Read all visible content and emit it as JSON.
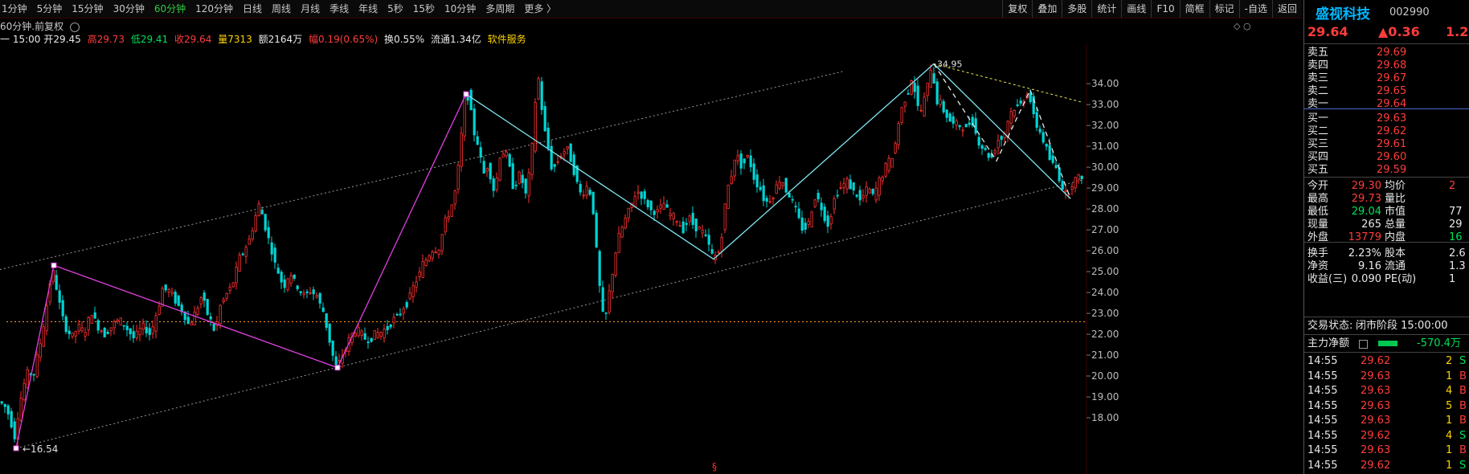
{
  "toolbar": {
    "periods": [
      "1分钟",
      "5分钟",
      "15分钟",
      "30分钟",
      "60分钟",
      "120分钟",
      "日线",
      "周线",
      "月线",
      "季线",
      "年线",
      "5秒",
      "15秒",
      "10分钟",
      "多周期",
      "更多 〉"
    ],
    "active_period": "60分钟",
    "tools": [
      "复权",
      "叠加",
      "多股",
      "统计",
      "画线",
      "F10",
      "简框",
      "标记",
      "-自选",
      "返回"
    ]
  },
  "chart_header": {
    "subtitle": "60分钟.前复权",
    "time": "一 15:00",
    "open_label": "开",
    "open": "29.45",
    "high_label": "高",
    "high": "29.73",
    "low_label": "低",
    "low": "29.41",
    "close_label": "收",
    "close": "29.64",
    "vol_label": "量",
    "vol": "7313",
    "amount_label": "额",
    "amount": "2164万",
    "change_label": "幅",
    "change": "0.19(0.65%)",
    "turnover_label": "换",
    "turnover": "0.55%",
    "float_label": "流通",
    "float": "1.34亿",
    "sector": "软件服务"
  },
  "chart_data": {
    "type": "candlestick",
    "ylim": [
      17.0,
      35.2
    ],
    "y_ticks": [
      "34.00",
      "33.00",
      "32.00",
      "31.00",
      "30.00",
      "29.00",
      "28.00",
      "27.00",
      "26.00",
      "25.00",
      "24.00",
      "23.00",
      "22.00",
      "21.00",
      "20.00",
      "19.00",
      "18.00"
    ],
    "price_path": [
      [
        0,
        18.8
      ],
      [
        8,
        18.6
      ],
      [
        12,
        18.3
      ],
      [
        16,
        18.0
      ],
      [
        20,
        16.9
      ],
      [
        26,
        18.3
      ],
      [
        32,
        19.5
      ],
      [
        38,
        20.2
      ],
      [
        45,
        20.1
      ],
      [
        52,
        21.4
      ],
      [
        58,
        22.6
      ],
      [
        63,
        23.8
      ],
      [
        67,
        25.3
      ],
      [
        72,
        24.4
      ],
      [
        78,
        23.2
      ],
      [
        85,
        22.3
      ],
      [
        92,
        21.8
      ],
      [
        100,
        22.4
      ],
      [
        108,
        22.0
      ],
      [
        116,
        23.1
      ],
      [
        124,
        22.4
      ],
      [
        132,
        22.0
      ],
      [
        140,
        22.3
      ],
      [
        150,
        22.7
      ],
      [
        160,
        22.3
      ],
      [
        170,
        21.8
      ],
      [
        180,
        22.4
      ],
      [
        190,
        22.0
      ],
      [
        198,
        23.0
      ],
      [
        206,
        24.3
      ],
      [
        214,
        24.0
      ],
      [
        222,
        23.6
      ],
      [
        230,
        23.1
      ],
      [
        238,
        22.4
      ],
      [
        246,
        23.0
      ],
      [
        254,
        23.9
      ],
      [
        262,
        22.9
      ],
      [
        270,
        22.1
      ],
      [
        278,
        23.5
      ],
      [
        286,
        24.0
      ],
      [
        294,
        24.6
      ],
      [
        302,
        25.8
      ],
      [
        310,
        26.2
      ],
      [
        318,
        27.2
      ],
      [
        325,
        28.2
      ],
      [
        332,
        27.3
      ],
      [
        340,
        26.1
      ],
      [
        348,
        25.0
      ],
      [
        356,
        24.3
      ],
      [
        364,
        24.9
      ],
      [
        372,
        24.3
      ],
      [
        380,
        23.8
      ],
      [
        388,
        24.1
      ],
      [
        396,
        23.9
      ],
      [
        404,
        23.2
      ],
      [
        412,
        21.9
      ],
      [
        420,
        20.4
      ],
      [
        428,
        20.9
      ],
      [
        436,
        21.6
      ],
      [
        444,
        22.2
      ],
      [
        452,
        22.0
      ],
      [
        460,
        21.7
      ],
      [
        470,
        22.0
      ],
      [
        480,
        22.1
      ],
      [
        490,
        22.6
      ],
      [
        500,
        23.0
      ],
      [
        510,
        23.6
      ],
      [
        520,
        24.5
      ],
      [
        530,
        25.4
      ],
      [
        540,
        26.0
      ],
      [
        550,
        26.1
      ],
      [
        556,
        27.4
      ],
      [
        564,
        28.0
      ],
      [
        570,
        29.0
      ],
      [
        576,
        31.0
      ],
      [
        580,
        33.2
      ],
      [
        586,
        33.5
      ],
      [
        592,
        31.8
      ],
      [
        598,
        31.0
      ],
      [
        604,
        29.6
      ],
      [
        610,
        30.2
      ],
      [
        618,
        28.7
      ],
      [
        626,
        30.8
      ],
      [
        634,
        30.5
      ],
      [
        642,
        29.0
      ],
      [
        650,
        29.7
      ],
      [
        658,
        28.6
      ],
      [
        664,
        30.5
      ],
      [
        670,
        33.6
      ],
      [
        674,
        34.5
      ],
      [
        678,
        32.2
      ],
      [
        684,
        31.2
      ],
      [
        690,
        29.8
      ],
      [
        696,
        30.3
      ],
      [
        702,
        30.7
      ],
      [
        710,
        30.9
      ],
      [
        718,
        29.7
      ],
      [
        726,
        28.6
      ],
      [
        734,
        29.1
      ],
      [
        740,
        28.4
      ],
      [
        746,
        25.5
      ],
      [
        752,
        23.0
      ],
      [
        756,
        22.7
      ],
      [
        760,
        23.8
      ],
      [
        766,
        25.2
      ],
      [
        772,
        26.6
      ],
      [
        780,
        27.4
      ],
      [
        788,
        28.2
      ],
      [
        796,
        28.9
      ],
      [
        804,
        28.5
      ],
      [
        812,
        28.0
      ],
      [
        820,
        27.8
      ],
      [
        828,
        28.3
      ],
      [
        836,
        27.7
      ],
      [
        844,
        27.5
      ],
      [
        852,
        27.0
      ],
      [
        860,
        27.6
      ],
      [
        868,
        27.2
      ],
      [
        876,
        26.9
      ],
      [
        884,
        26.4
      ],
      [
        890,
        25.6
      ],
      [
        896,
        25.8
      ],
      [
        902,
        27.0
      ],
      [
        906,
        28.6
      ],
      [
        912,
        29.5
      ],
      [
        918,
        30.6
      ],
      [
        926,
        30.1
      ],
      [
        934,
        30.6
      ],
      [
        940,
        29.6
      ],
      [
        948,
        29.0
      ],
      [
        956,
        28.3
      ],
      [
        964,
        28.6
      ],
      [
        972,
        29.4
      ],
      [
        978,
        29.2
      ],
      [
        984,
        28.7
      ],
      [
        990,
        28.2
      ],
      [
        996,
        27.6
      ],
      [
        1002,
        27.0
      ],
      [
        1010,
        27.4
      ],
      [
        1018,
        28.8
      ],
      [
        1026,
        27.9
      ],
      [
        1034,
        27.2
      ],
      [
        1042,
        28.7
      ],
      [
        1050,
        29.1
      ],
      [
        1058,
        29.3
      ],
      [
        1066,
        28.8
      ],
      [
        1074,
        28.4
      ],
      [
        1082,
        29.0
      ],
      [
        1090,
        28.6
      ],
      [
        1098,
        29.4
      ],
      [
        1106,
        30.1
      ],
      [
        1114,
        30.5
      ],
      [
        1120,
        31.9
      ],
      [
        1126,
        33.0
      ],
      [
        1132,
        33.6
      ],
      [
        1138,
        34.3
      ],
      [
        1144,
        33.0
      ],
      [
        1150,
        32.6
      ],
      [
        1156,
        33.8
      ],
      [
        1162,
        34.9
      ],
      [
        1168,
        33.2
      ],
      [
        1174,
        33.0
      ],
      [
        1180,
        32.5
      ],
      [
        1188,
        32.1
      ],
      [
        1196,
        32.0
      ],
      [
        1204,
        31.8
      ],
      [
        1212,
        32.4
      ],
      [
        1220,
        31.2
      ],
      [
        1228,
        30.8
      ],
      [
        1236,
        30.4
      ],
      [
        1244,
        31.3
      ],
      [
        1252,
        31.5
      ],
      [
        1260,
        32.6
      ],
      [
        1268,
        32.9
      ],
      [
        1276,
        33.2
      ],
      [
        1282,
        33.7
      ],
      [
        1288,
        32.6
      ],
      [
        1294,
        31.9
      ],
      [
        1300,
        31.4
      ],
      [
        1306,
        30.7
      ],
      [
        1312,
        30.2
      ],
      [
        1318,
        29.9
      ],
      [
        1324,
        29.1
      ],
      [
        1330,
        28.6
      ],
      [
        1336,
        29.2
      ],
      [
        1342,
        29.4
      ],
      [
        1348,
        29.6
      ]
    ],
    "zigzag_magenta": [
      [
        20,
        16.54
      ],
      [
        67,
        25.3
      ],
      [
        420,
        20.4
      ],
      [
        580,
        33.5
      ]
    ],
    "zigzag_cyan": [
      [
        580,
        33.5
      ],
      [
        888,
        25.6
      ],
      [
        1162,
        34.95
      ],
      [
        1332,
        28.5
      ]
    ],
    "dashed_cyan": [
      [
        1162,
        34.95
      ],
      [
        1240,
        30.3
      ],
      [
        1282,
        33.7
      ],
      [
        1332,
        28.5
      ]
    ],
    "channel_top": [
      [
        0,
        25.1
      ],
      [
        1050,
        34.6
      ]
    ],
    "channel_bottom": [
      [
        20,
        16.54
      ],
      [
        1348,
        29.4
      ]
    ],
    "resistance": [
      [
        1162,
        34.95
      ],
      [
        1348,
        33.1
      ]
    ],
    "hline": 22.6,
    "labels": {
      "low": "16.54",
      "high": "34.95",
      "marker": "§"
    }
  },
  "panel": {
    "name": "盛视科技",
    "code": "002990",
    "price": "29.64",
    "change": "▲0.36",
    "pct": "1.2",
    "asks": [
      {
        "label": "卖五",
        "price": "29.69"
      },
      {
        "label": "卖四",
        "price": "29.68"
      },
      {
        "label": "卖三",
        "price": "29.67"
      },
      {
        "label": "卖二",
        "price": "29.65"
      },
      {
        "label": "卖一",
        "price": "29.64"
      }
    ],
    "bids": [
      {
        "label": "买一",
        "price": "29.63"
      },
      {
        "label": "买二",
        "price": "29.62"
      },
      {
        "label": "买三",
        "price": "29.61"
      },
      {
        "label": "买四",
        "price": "29.60"
      },
      {
        "label": "买五",
        "price": "29.59"
      }
    ],
    "stats": [
      {
        "l1": "今开",
        "v1": "29.30",
        "l2": "均价",
        "v2": "2"
      },
      {
        "l1": "最高",
        "v1": "29.73",
        "l2": "量比",
        "v2": ""
      },
      {
        "l1": "最低",
        "v1": "29.04",
        "l2": "市值",
        "v2": "77"
      },
      {
        "l1": "现量",
        "v1": "265",
        "l2": "总量",
        "v2": "29"
      },
      {
        "l1": "外盘",
        "v1": "13779",
        "l2": "内盘",
        "v2": "16"
      },
      {
        "l1": "换手",
        "v1": "2.23%",
        "l2": "股本",
        "v2": "2.6"
      },
      {
        "l1": "净资",
        "v1": "9.16",
        "l2": "流通",
        "v2": "1.3"
      },
      {
        "l1": "收益(三)",
        "v1": "0.090",
        "l2": "PE(动)",
        "v2": "1"
      }
    ],
    "trade_status_label": "交易状态:",
    "trade_status": "闭市阶段 15:00:00",
    "netflow_label": "主力净额",
    "netflow": "-570.4万",
    "ticks": [
      {
        "t": "14:55",
        "p": "29.62",
        "v": "2",
        "s": "S"
      },
      {
        "t": "14:55",
        "p": "29.63",
        "v": "1",
        "s": "B"
      },
      {
        "t": "14:55",
        "p": "29.63",
        "v": "4",
        "s": "B"
      },
      {
        "t": "14:55",
        "p": "29.63",
        "v": "5",
        "s": "B"
      },
      {
        "t": "14:55",
        "p": "29.63",
        "v": "1",
        "s": "B"
      },
      {
        "t": "14:55",
        "p": "29.62",
        "v": "4",
        "s": "S"
      },
      {
        "t": "14:55",
        "p": "29.63",
        "v": "1",
        "s": "B"
      },
      {
        "t": "14:55",
        "p": "29.62",
        "v": "1",
        "s": "S"
      }
    ]
  }
}
